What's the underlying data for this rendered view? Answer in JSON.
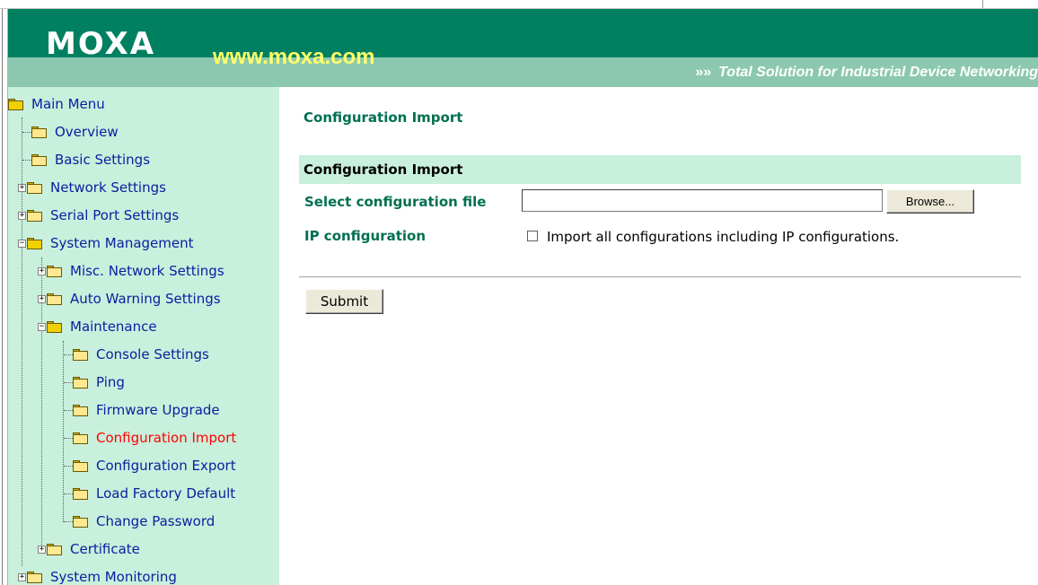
{
  "header": {
    "logo": "MOXA",
    "site": "www.moxa.com",
    "tagline_arrows": "»»",
    "tagline": "Total Solution for Industrial Device Networking"
  },
  "sidebar": {
    "items": [
      {
        "label": "Main Menu"
      },
      {
        "label": "Overview"
      },
      {
        "label": "Basic Settings"
      },
      {
        "label": "Network Settings"
      },
      {
        "label": "Serial Port Settings"
      },
      {
        "label": "System Management"
      },
      {
        "label": "Misc. Network Settings"
      },
      {
        "label": "Auto Warning Settings"
      },
      {
        "label": "Maintenance"
      },
      {
        "label": "Console Settings"
      },
      {
        "label": "Ping"
      },
      {
        "label": "Firmware Upgrade"
      },
      {
        "label": "Configuration Import"
      },
      {
        "label": "Configuration Export"
      },
      {
        "label": "Load Factory Default"
      },
      {
        "label": "Change Password"
      },
      {
        "label": "Certificate"
      },
      {
        "label": "System Monitoring"
      }
    ]
  },
  "main": {
    "title": "Configuration Import",
    "section_title": "Configuration Import",
    "file_label": "Select configuration file",
    "file_value": "",
    "browse_label": "Browse...",
    "ip_label": "IP configuration",
    "ip_checkbox_checked": false,
    "ip_checkbox_label": "Import all configurations including IP configurations.",
    "submit_label": "Submit"
  },
  "colors": {
    "header_green": "#008060",
    "header_light": "#8cc8b0",
    "sidebar_bg": "#c8f0dc",
    "link_blue": "#0a1ea0",
    "active_red": "#ff0000",
    "label_green": "#007050"
  }
}
